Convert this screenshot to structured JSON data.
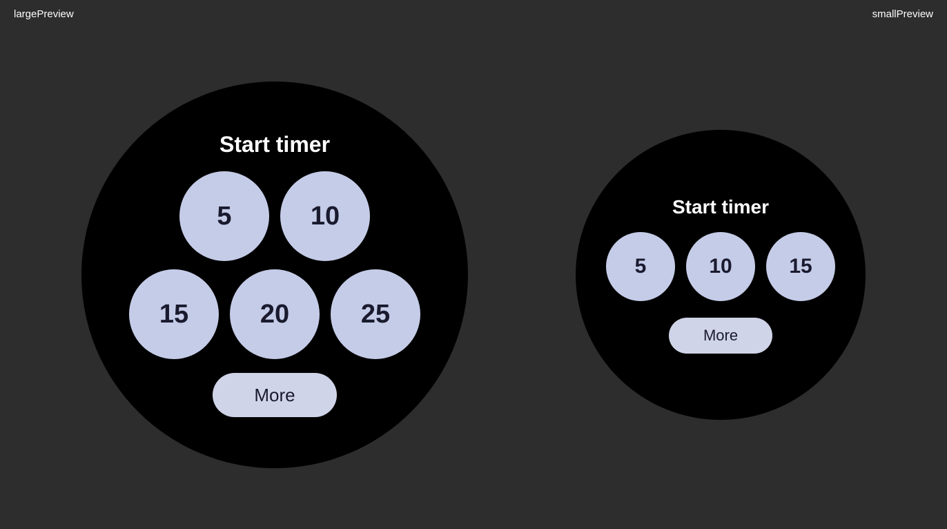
{
  "labels": {
    "large": "largePreview",
    "small": "smallPreview"
  },
  "large_preview": {
    "title": "Start timer",
    "row1": [
      "5",
      "10"
    ],
    "row2": [
      "15",
      "20",
      "25"
    ],
    "more": "More"
  },
  "small_preview": {
    "title": "Start timer",
    "row1": [
      "5",
      "10",
      "15"
    ],
    "more": "More"
  }
}
